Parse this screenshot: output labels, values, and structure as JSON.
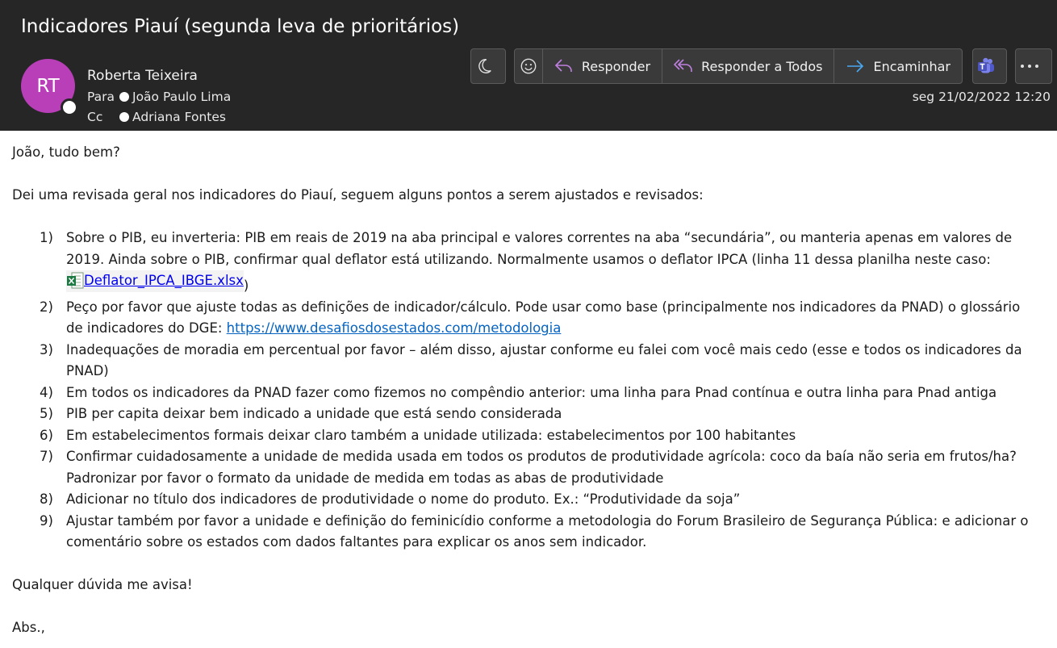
{
  "subject": "Indicadores Piauí (segunda leva de prioritários)",
  "sender": {
    "initials": "RT",
    "name": "Roberta Teixeira",
    "avatar_color": "#b83fb8"
  },
  "to": {
    "label": "Para",
    "name": "João Paulo Lima"
  },
  "cc": {
    "label": "Cc",
    "name": "Adriana Fontes"
  },
  "date": "seg 21/02/2022 12:20",
  "toolbar": {
    "reply": "Responder",
    "reply_all": "Responder a Todos",
    "forward": "Encaminhar",
    "icons": [
      "moon-icon",
      "emoji-icon",
      "reply-icon",
      "reply-all-icon",
      "forward-icon",
      "teams-icon",
      "more-icon"
    ]
  },
  "body": {
    "greeting": "João, tudo bem?",
    "intro": "Dei uma revisada geral nos indicadores do Piauí, seguem alguns pontos a serem ajustados e revisados:",
    "items": [
      {
        "num": "1)",
        "lines": [
          "Sobre o PIB, eu inverteria: PIB em reais de 2019 na aba principal e valores correntes na aba “secundária”, ou manteria apenas em valores de",
          "2019. Ainda sobre o PIB, confirmar qual deflator está utilizando. Normalmente usamos o deflator IPCA (linha 11 dessa planilha neste caso:"
        ],
        "attachment": "Deflator_IPCA_IBGE.xlsx",
        "attachment_close": ")"
      },
      {
        "num": "2)",
        "lines": [
          "Peço por favor que ajuste todas as definições de indicador/cálculo. Pode usar como base (principalmente nos indicadores da PNAD) o glossário",
          "de indicadores do DGE: "
        ],
        "link": "https://www.desafiosdosestados.com/metodologia"
      },
      {
        "num": "3)",
        "lines": [
          "Inadequações de moradia em percentual por favor – além disso, ajustar conforme eu falei com você mais cedo (esse e todos os indicadores da",
          "PNAD)"
        ]
      },
      {
        "num": "4)",
        "lines": [
          "Em todos os indicadores da PNAD fazer como fizemos no compêndio anterior: uma linha para Pnad contínua e outra linha para Pnad antiga"
        ]
      },
      {
        "num": "5)",
        "lines": [
          "PIB per capita deixar bem indicado a unidade que está sendo considerada"
        ]
      },
      {
        "num": "6)",
        "lines": [
          "Em estabelecimentos formais deixar claro também a unidade utilizada: estabelecimentos por 100 habitantes"
        ]
      },
      {
        "num": "7)",
        "lines": [
          "Confirmar cuidadosamente a unidade de medida usada em todos os produtos de produtividade agrícola: coco da baía não seria em frutos/ha?",
          "Padronizar por favor o formato da unidade de medida em todas as abas de produtividade"
        ]
      },
      {
        "num": "8)",
        "lines": [
          "Adicionar no título dos indicadores de produtividade o nome do produto. Ex.: “Produtividade da soja”"
        ]
      },
      {
        "num": "9)",
        "lines": [
          "Ajustar também por favor a unidade e definição do feminicídio conforme a metodologia do Forum Brasileiro de Segurança Pública: e adicionar o",
          "comentário sobre os estados com dados faltantes para explicar os anos sem indicador."
        ]
      }
    ],
    "closing": "Qualquer dúvida me avisa!",
    "signoff": "Abs.,"
  }
}
